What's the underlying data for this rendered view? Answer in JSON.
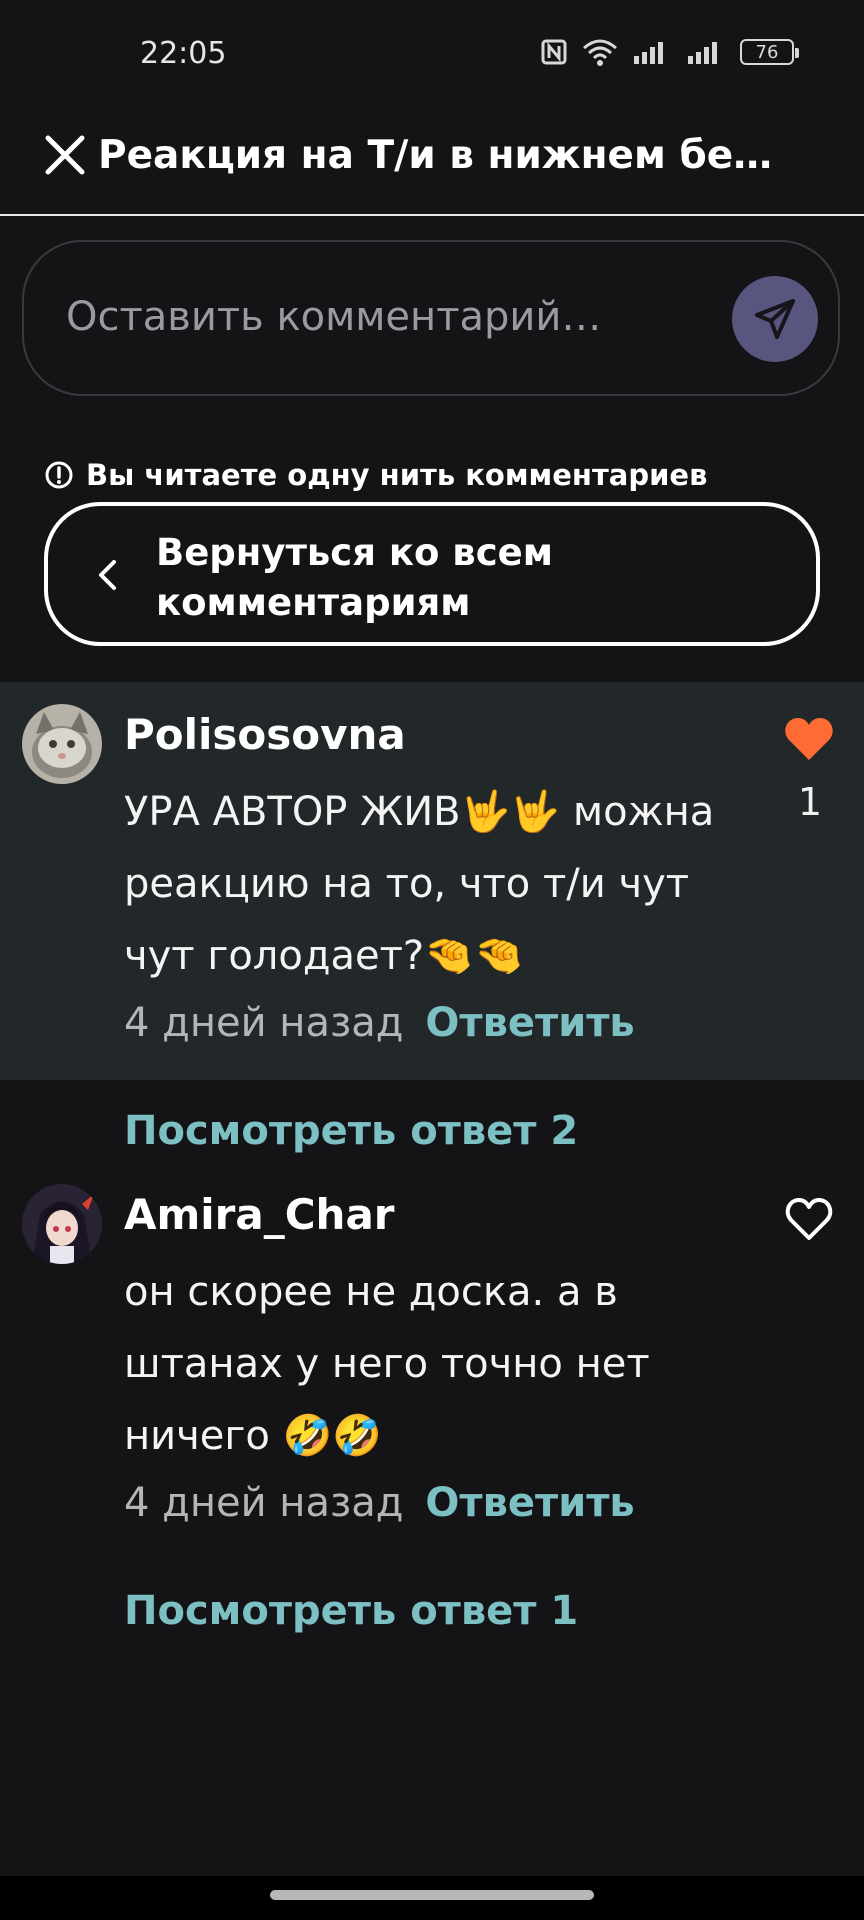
{
  "status_bar": {
    "time": "22:05",
    "battery": "76",
    "icons": [
      "nfc-icon",
      "wifi-icon",
      "signal-icon",
      "signal-icon",
      "battery-icon"
    ]
  },
  "header": {
    "title": "Реакция на Т/и в нижнем бе…",
    "close_icon": "close-icon"
  },
  "comment_input": {
    "placeholder": "Оставить комментарий…",
    "send_icon": "send-icon",
    "send_color": "#58557e"
  },
  "thread": {
    "notice": "Вы читаете одну нить комментариев",
    "back_label": "Вернуться ко всем комментариям"
  },
  "comments": [
    {
      "author": "Polisosovna",
      "text": "УРА АВТОР ЖИВ🤟🤟 можна реакцию на то, что т/и чут чут голодает?🤏🤏",
      "time": "4 дней назад",
      "reply_label": "Ответить",
      "likes": "1",
      "liked": true,
      "view_replies": "Посмотреть ответ 2"
    },
    {
      "author": "Amira_Char",
      "text": "он скорее не доска. а в штанах у него точно нет ничего 🤣🤣",
      "time": "4 дней назад",
      "reply_label": "Ответить",
      "liked": false,
      "view_replies": "Посмотреть ответ 1"
    }
  ],
  "colors": {
    "background": "#141416",
    "highlight": "#222829",
    "accent": "#7cc0c4",
    "like_active": "#ff6b35"
  }
}
